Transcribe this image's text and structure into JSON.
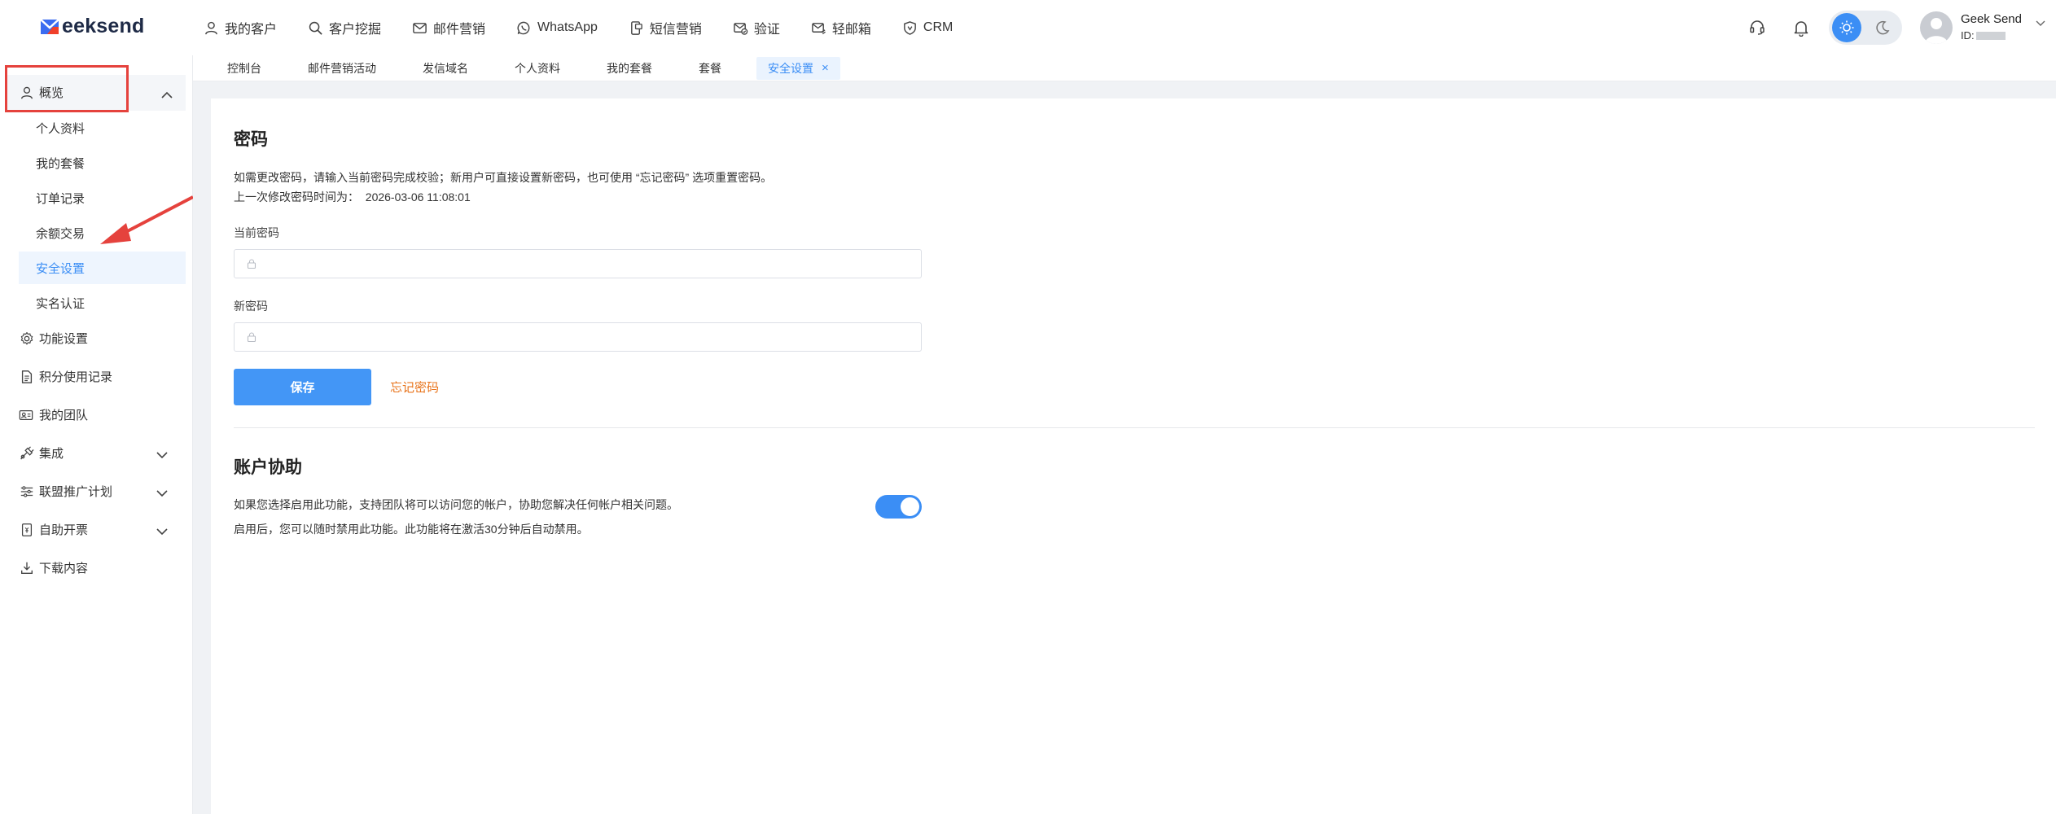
{
  "app": {
    "logo_text": "eeksend",
    "logo_letter": "G"
  },
  "topnav": [
    {
      "label": "我的客户",
      "icon": "user-icon"
    },
    {
      "label": "客户挖掘",
      "icon": "search-icon"
    },
    {
      "label": "邮件营销",
      "icon": "mail-icon"
    },
    {
      "label": "WhatsApp",
      "icon": "whatsapp-icon"
    },
    {
      "label": "短信营销",
      "icon": "sms-icon"
    },
    {
      "label": "验证",
      "icon": "verify-icon"
    },
    {
      "label": "轻邮箱",
      "icon": "light-mail-icon"
    },
    {
      "label": "CRM",
      "icon": "crm-icon"
    }
  ],
  "user": {
    "name": "Geek Send",
    "id_label": "ID:"
  },
  "tabs": [
    {
      "label": "控制台",
      "active": false
    },
    {
      "label": "邮件营销活动",
      "active": false
    },
    {
      "label": "发信域名",
      "active": false
    },
    {
      "label": "个人资料",
      "active": false
    },
    {
      "label": "我的套餐",
      "active": false
    },
    {
      "label": "套餐",
      "active": false
    },
    {
      "label": "安全设置",
      "active": true,
      "close": "×"
    }
  ],
  "sidebar": {
    "overview": "概览",
    "sub_items": [
      "个人资料",
      "我的套餐",
      "订单记录",
      "余额交易",
      "安全设置",
      "实名认证"
    ],
    "active_sub": "安全设置",
    "items": [
      {
        "label": "功能设置",
        "icon": "gear-icon"
      },
      {
        "label": "积分使用记录",
        "icon": "document-icon"
      },
      {
        "label": "我的团队",
        "icon": "id-card-icon"
      },
      {
        "label": "集成",
        "icon": "plug-icon"
      },
      {
        "label": "联盟推广计划",
        "icon": "sliders-icon"
      },
      {
        "label": "自助开票",
        "icon": "invoice-icon"
      },
      {
        "label": "下载内容",
        "icon": "download-icon"
      }
    ]
  },
  "password_section": {
    "title": "密码",
    "desc_line1": "如需更改密码，请输入当前密码完成校验；新用户可直接设置新密码，也可使用 “忘记密码” 选项重置密码。",
    "desc_line2_label": "上一次修改密码时间为：",
    "desc_line2_time": "2026-03-06 11:08:01",
    "current_label": "当前密码",
    "new_label": "新密码",
    "save_label": "保存",
    "forgot_label": "忘记密码"
  },
  "assist_section": {
    "title": "账户协助",
    "desc_line1": "如果您选择启用此功能，支持团队将可以访问您的帐户，协助您解决任何帐户相关问题。",
    "desc_line2": "启用后，您可以随时禁用此功能。此功能将在激活30分钟后自动禁用。",
    "enabled": true
  },
  "colors": {
    "accent": "#3b8ef5",
    "save_button": "#4396f6",
    "forgot_link": "#e8731a",
    "annotation_red": "#e5423d"
  }
}
